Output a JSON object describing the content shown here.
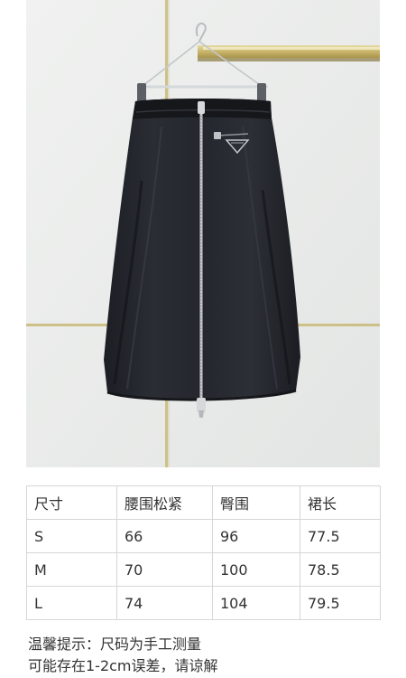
{
  "product": {
    "image_alt": "black-zip-skirt-photo",
    "colors": {
      "skirt": "#22252b",
      "zipper": "#c9cbcd",
      "wall": "#e8eae9",
      "gold_rail": "#c9b56a"
    }
  },
  "size_table": {
    "headers": [
      "尺寸",
      "腰围松紧",
      "臀围",
      "裙长"
    ],
    "rows": [
      [
        "S",
        "66",
        "96",
        "77.5"
      ],
      [
        "M",
        "70",
        "100",
        "78.5"
      ],
      [
        "L",
        "74",
        "104",
        "79.5"
      ]
    ]
  },
  "notes": {
    "line1": "温馨提示：尺码为手工测量",
    "line2": "可能存在1-2cm误差，请谅解"
  }
}
